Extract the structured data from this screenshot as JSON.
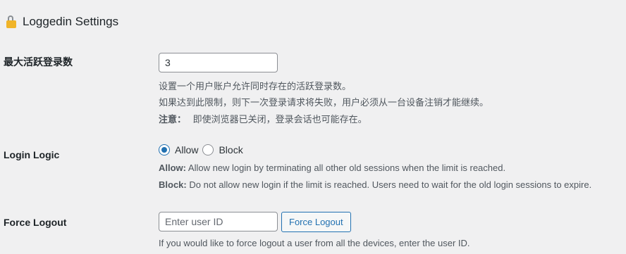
{
  "header": {
    "title": "Loggedin Settings",
    "icon": "lock-icon"
  },
  "max_logins": {
    "label": "最大活跃登录数",
    "value": "3",
    "desc_line1": "设置一个用户账户允许同时存在的活跃登录数。",
    "desc_line2": "如果达到此限制，则下一次登录请求将失败，用户必须从一台设备注销才能继续。",
    "note_label": "注意：",
    "note_text": "即使浏览器已关闭，登录会话也可能存在。"
  },
  "login_logic": {
    "label": "Login Logic",
    "options": [
      {
        "label": "Allow",
        "checked": true
      },
      {
        "label": "Block",
        "checked": false
      }
    ],
    "allow_label": "Allow:",
    "allow_text": "Allow new login by terminating all other old sessions when the limit is reached.",
    "block_label": "Block:",
    "block_text": "Do not allow new login if the limit is reached. Users need to wait for the old login sessions to expire."
  },
  "force_logout": {
    "label": "Force Logout",
    "placeholder": "Enter user ID",
    "button_label": "Force Logout",
    "desc": "If you would like to force logout a user from all the devices, enter the user ID."
  },
  "colors": {
    "background": "#f0f0f1",
    "accent": "#2271b1"
  }
}
